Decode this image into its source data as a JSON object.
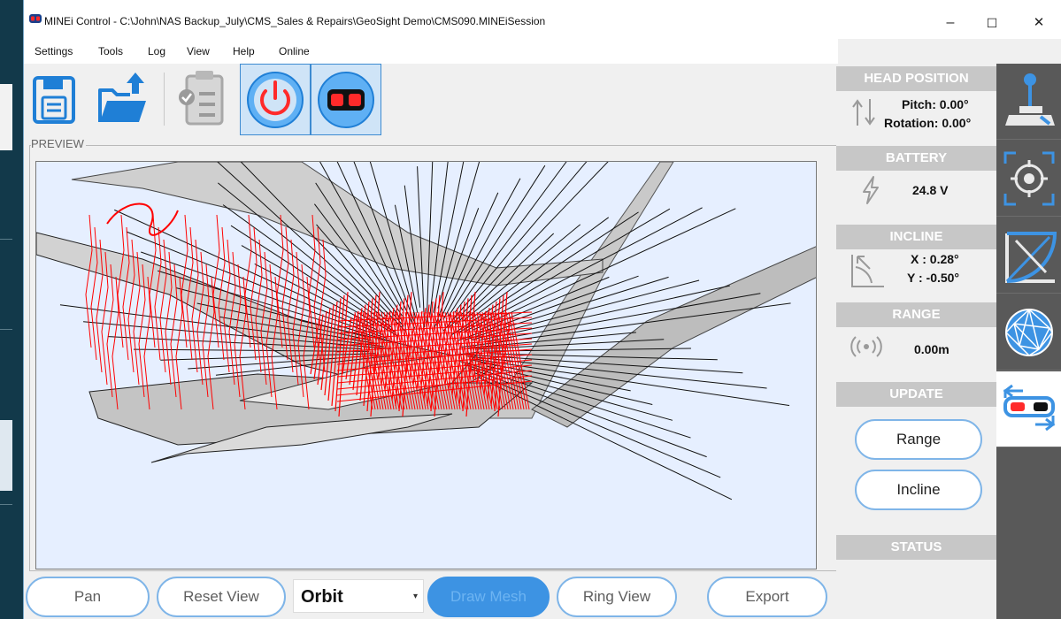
{
  "window": {
    "title": "MINEi Control - C:\\John\\NAS Backup_July\\CMS_Sales & Repairs\\GeoSight Demo\\CMS090.MINEiSession",
    "minimize_glyph": "–",
    "maximize_glyph": "☐",
    "close_glyph": "✕"
  },
  "menu": [
    "Settings",
    "Tools",
    "Log",
    "View",
    "Help",
    "Online"
  ],
  "toolbar": {
    "icons": [
      "save-disk-icon",
      "open-folder-icon",
      "checklist-icon",
      "power-icon",
      "goggles-icon"
    ]
  },
  "preview": {
    "label": "PREVIEW"
  },
  "controls": {
    "pan": "Pan",
    "reset_view": "Reset View",
    "camera_mode": "Orbit",
    "camera_caret": "▾",
    "draw_mesh": "Draw Mesh",
    "ring_view": "Ring View",
    "export": "Export"
  },
  "status_panel": {
    "head_position": {
      "header": "HEAD POSITION",
      "pitch": "Pitch: 0.00°",
      "rotation": "Rotation: 0.00°"
    },
    "battery": {
      "header": "BATTERY",
      "value": "24.8 V"
    },
    "incline": {
      "header": "INCLINE",
      "x": "X : 0.28°",
      "y": "Y : -0.50°"
    },
    "range": {
      "header": "RANGE",
      "value": "0.00m"
    },
    "update": {
      "header": "UPDATE",
      "range_button": "Range",
      "incline_button": "Incline"
    },
    "status": {
      "header": "STATUS"
    }
  },
  "side_tabs": [
    "joystick-control-icon",
    "target-scan-icon",
    "angle-measure-icon",
    "mesh-sphere-icon",
    "goggles-view-icon"
  ],
  "colors": {
    "accent": "#3d93e3",
    "pill_border": "#7fb5e8",
    "panel_header": "#c7c7c7",
    "scan_red": "#ff0000",
    "viewport_bg": "#e6efff"
  }
}
